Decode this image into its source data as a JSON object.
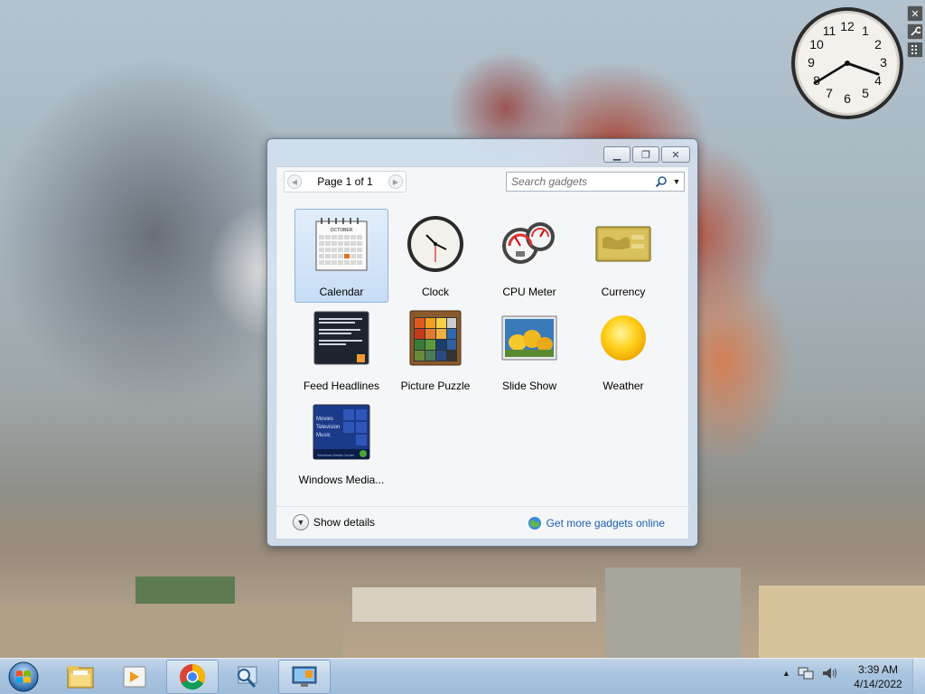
{
  "gallery": {
    "window_buttons": {
      "minimize": "▁",
      "restore": "❐",
      "close": "✕"
    },
    "pager": {
      "label": "Page 1 of 1"
    },
    "search": {
      "placeholder": "Search gadgets"
    },
    "gadgets": [
      {
        "label": "Calendar",
        "icon": "calendar-icon",
        "selected": true
      },
      {
        "label": "Clock",
        "icon": "clock-icon"
      },
      {
        "label": "CPU Meter",
        "icon": "cpu-meter-icon"
      },
      {
        "label": "Currency",
        "icon": "currency-icon"
      },
      {
        "label": "Feed Headlines",
        "icon": "feed-headlines-icon"
      },
      {
        "label": "Picture Puzzle",
        "icon": "picture-puzzle-icon"
      },
      {
        "label": "Slide Show",
        "icon": "slide-show-icon"
      },
      {
        "label": "Weather",
        "icon": "weather-icon"
      },
      {
        "label": "Windows Media...",
        "icon": "windows-media-icon"
      }
    ],
    "calendar_icon": {
      "month": "OCTOBER"
    },
    "media_icon": {
      "lines": [
        "Movies",
        "Television",
        "Music"
      ],
      "footer": "Windows Media Center"
    },
    "footer": {
      "show_details": "Show details",
      "get_more": "Get more gadgets online"
    }
  },
  "desktop_clock": {
    "numerals": [
      "12",
      "1",
      "2",
      "3",
      "4",
      "5",
      "6",
      "7",
      "8",
      "9",
      "10",
      "11"
    ],
    "time": "3:39"
  },
  "gadget_controls": {
    "close": "✕"
  },
  "taskbar": {
    "apps": [
      "windows-explorer-icon",
      "media-player-icon",
      "chrome-icon",
      "search-magnifier-icon",
      "desktop-gadget-gallery-icon"
    ],
    "time": "3:39 AM",
    "date": "4/14/2022"
  }
}
